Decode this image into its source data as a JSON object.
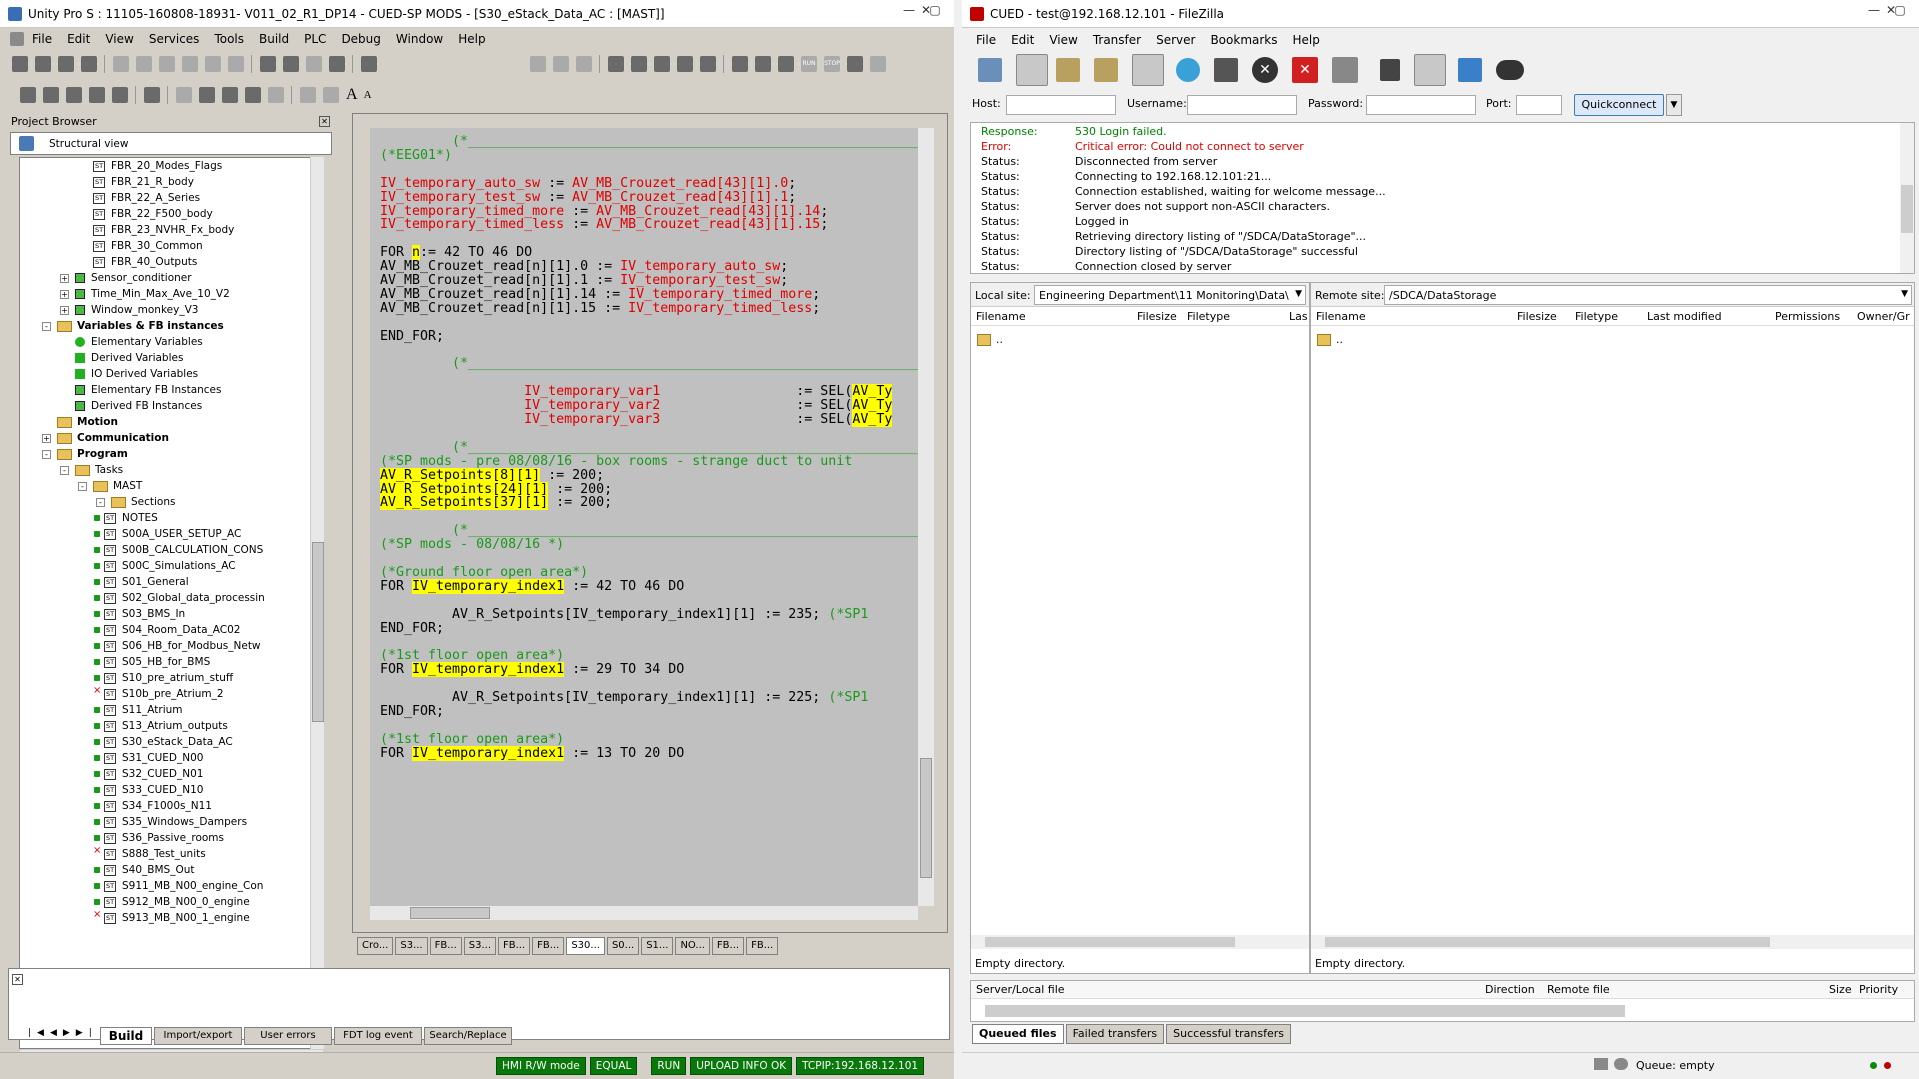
{
  "unity": {
    "title": "Unity Pro S : 11105-160808-18931- V011_02_R1_DP14 - CUED-SP MODS - [S30_eStack_Data_AC : [MAST]]",
    "menu": [
      "File",
      "Edit",
      "View",
      "Services",
      "Tools",
      "Build",
      "PLC",
      "Debug",
      "Window",
      "Help"
    ],
    "project_browser": {
      "title": "Project Browser",
      "view_label": "Structural view",
      "tree": [
        {
          "label": "FBR_20_Modes_Flags",
          "kind": "st",
          "indent": 4
        },
        {
          "label": "FBR_21_R_body",
          "kind": "st",
          "indent": 4
        },
        {
          "label": "FBR_22_A_Series",
          "kind": "st",
          "indent": 4
        },
        {
          "label": "FBR_22_F500_body",
          "kind": "st",
          "indent": 4
        },
        {
          "label": "FBR_23_NVHR_Fx_body",
          "kind": "st",
          "indent": 4
        },
        {
          "label": "FBR_30_Common",
          "kind": "st",
          "indent": 4
        },
        {
          "label": "FBR_40_Outputs",
          "kind": "st",
          "indent": 4
        },
        {
          "label": "Sensor_conditioner",
          "kind": "grid",
          "indent": 2,
          "exp": "+"
        },
        {
          "label": "Time_Min_Max_Ave_10_V2",
          "kind": "grid",
          "indent": 2,
          "exp": "+"
        },
        {
          "label": "Window_monkey_V3",
          "kind": "grid",
          "indent": 2,
          "exp": "+"
        },
        {
          "label": "Variables & FB instances",
          "kind": "folder",
          "indent": 1,
          "exp": "-",
          "bold": true
        },
        {
          "label": "Elementary Variables",
          "kind": "dot",
          "indent": 2
        },
        {
          "label": "Derived Variables",
          "kind": "sq",
          "indent": 2
        },
        {
          "label": "IO Derived Variables",
          "kind": "sq",
          "indent": 2
        },
        {
          "label": "Elementary FB Instances",
          "kind": "grid",
          "indent": 2
        },
        {
          "label": "Derived FB Instances",
          "kind": "grid",
          "indent": 2
        },
        {
          "label": "Motion",
          "kind": "folder",
          "indent": 1,
          "bold": true
        },
        {
          "label": "Communication",
          "kind": "folder",
          "indent": 1,
          "exp": "+",
          "bold": true
        },
        {
          "label": "Program",
          "kind": "folder",
          "indent": 1,
          "exp": "-",
          "bold": true
        },
        {
          "label": "Tasks",
          "kind": "folder",
          "indent": 2,
          "exp": "-"
        },
        {
          "label": "MAST",
          "kind": "folder",
          "indent": 3,
          "exp": "-"
        },
        {
          "label": "Sections",
          "kind": "folder",
          "indent": 4,
          "exp": "-"
        },
        {
          "label": "NOTES",
          "kind": "st",
          "indent": 5,
          "mark": "g"
        },
        {
          "label": "S00A_USER_SETUP_AC",
          "kind": "st",
          "indent": 5,
          "mark": "g"
        },
        {
          "label": "S00B_CALCULATION_CONS",
          "kind": "st",
          "indent": 5,
          "mark": "g"
        },
        {
          "label": "S00C_Simulations_AC",
          "kind": "st",
          "indent": 5,
          "mark": "g"
        },
        {
          "label": "S01_General",
          "kind": "st",
          "indent": 5,
          "mark": "g"
        },
        {
          "label": "S02_Global_data_processin",
          "kind": "st",
          "indent": 5,
          "mark": "g"
        },
        {
          "label": "S03_BMS_In",
          "kind": "st",
          "indent": 5,
          "mark": "g"
        },
        {
          "label": "S04_Room_Data_AC02",
          "kind": "st",
          "indent": 5,
          "mark": "g"
        },
        {
          "label": "S06_HB_for_Modbus_Netw",
          "kind": "st",
          "indent": 5,
          "mark": "g"
        },
        {
          "label": "S05_HB_for_BMS",
          "kind": "st",
          "indent": 5,
          "mark": "g"
        },
        {
          "label": "S10_pre_atrium_stuff",
          "kind": "st",
          "indent": 5,
          "mark": "g"
        },
        {
          "label": "S10b_pre_Atrium_2",
          "kind": "st",
          "indent": 5,
          "mark": "r"
        },
        {
          "label": "S11_Atrium",
          "kind": "st",
          "indent": 5,
          "mark": "g"
        },
        {
          "label": "S13_Atrium_outputs",
          "kind": "st",
          "indent": 5,
          "mark": "g"
        },
        {
          "label": "S30_eStack_Data_AC",
          "kind": "st",
          "indent": 5,
          "mark": "g"
        },
        {
          "label": "S31_CUED_N00",
          "kind": "st",
          "indent": 5,
          "mark": "g"
        },
        {
          "label": "S32_CUED_N01",
          "kind": "st",
          "indent": 5,
          "mark": "g"
        },
        {
          "label": "S33_CUED_N10",
          "kind": "st",
          "indent": 5,
          "mark": "g"
        },
        {
          "label": "S34_F1000s_N11",
          "kind": "st",
          "indent": 5,
          "mark": "g"
        },
        {
          "label": "S35_Windows_Dampers",
          "kind": "st",
          "indent": 5,
          "mark": "g"
        },
        {
          "label": "S36_Passive_rooms",
          "kind": "st",
          "indent": 5,
          "mark": "g"
        },
        {
          "label": "S888_Test_units",
          "kind": "st",
          "indent": 5,
          "mark": "r"
        },
        {
          "label": "S40_BMS_Out",
          "kind": "st",
          "indent": 5,
          "mark": "g"
        },
        {
          "label": "S911_MB_N00_engine_Con",
          "kind": "st",
          "indent": 5,
          "mark": "g"
        },
        {
          "label": "S912_MB_N00_0_engine",
          "kind": "st",
          "indent": 5,
          "mark": "g"
        },
        {
          "label": "S913_MB_N00_1_engine",
          "kind": "st",
          "indent": 5,
          "mark": "r"
        }
      ]
    },
    "code_lines": [
      [
        {
          "t": "         (*____________________________________________________________",
          "c": "cmt"
        }
      ],
      [
        {
          "t": "(*EEG01*)",
          "c": "cmt"
        }
      ],
      [],
      [
        {
          "t": "IV_temporary_auto_sw",
          "c": "var"
        },
        {
          "t": " := "
        },
        {
          "t": "AV_MB_Crouzet_read[43][1].0",
          "c": "var"
        },
        {
          "t": ";"
        }
      ],
      [
        {
          "t": "IV_temporary_test_sw",
          "c": "var"
        },
        {
          "t": " := "
        },
        {
          "t": "AV_MB_Crouzet_read[43][1].1",
          "c": "var"
        },
        {
          "t": ";"
        }
      ],
      [
        {
          "t": "IV_temporary_timed_more",
          "c": "var"
        },
        {
          "t": " := "
        },
        {
          "t": "AV_MB_Crouzet_read[43][1].14",
          "c": "var"
        },
        {
          "t": ";"
        }
      ],
      [
        {
          "t": "IV_temporary_timed_less",
          "c": "var"
        },
        {
          "t": " := "
        },
        {
          "t": "AV_MB_Crouzet_read[43][1].15",
          "c": "var"
        },
        {
          "t": ";"
        }
      ],
      [],
      [
        {
          "t": "FOR "
        },
        {
          "t": "n",
          "c": "hl"
        },
        {
          "t": ":= 42 TO 46 DO"
        }
      ],
      [
        {
          "t": "AV_MB_Crouzet_read[n][1].0 := "
        },
        {
          "t": "IV_temporary_auto_sw",
          "c": "var"
        },
        {
          "t": ";"
        }
      ],
      [
        {
          "t": "AV_MB_Crouzet_read[n][1].1 := "
        },
        {
          "t": "IV_temporary_test_sw",
          "c": "var"
        },
        {
          "t": ";"
        }
      ],
      [
        {
          "t": "AV_MB_Crouzet_read[n][1].14 := "
        },
        {
          "t": "IV_temporary_timed_more",
          "c": "var"
        },
        {
          "t": ";"
        }
      ],
      [
        {
          "t": "AV_MB_Crouzet_read[n][1].15 := "
        },
        {
          "t": "IV_temporary_timed_less",
          "c": "var"
        },
        {
          "t": ";"
        }
      ],
      [],
      [
        {
          "t": "END_FOR;"
        }
      ],
      [],
      [
        {
          "t": "         (*____________________________________________________________",
          "c": "cmt"
        }
      ],
      [],
      [
        {
          "t": "                  "
        },
        {
          "t": "IV_temporary_var1",
          "c": "var"
        },
        {
          "t": "                 := SEL("
        },
        {
          "t": "AV_Ty",
          "c": "hl"
        }
      ],
      [
        {
          "t": "                  "
        },
        {
          "t": "IV_temporary_var2",
          "c": "var"
        },
        {
          "t": "                 := SEL("
        },
        {
          "t": "AV_Ty",
          "c": "hl"
        }
      ],
      [
        {
          "t": "                  "
        },
        {
          "t": "IV_temporary_var3",
          "c": "var"
        },
        {
          "t": "                 := SEL("
        },
        {
          "t": "AV_Ty",
          "c": "hl"
        }
      ],
      [],
      [
        {
          "t": "         (*____________________________________________________________",
          "c": "cmt"
        }
      ],
      [
        {
          "t": "(*SP mods - pre 08/08/16 - box rooms - strange duct to unit",
          "c": "cmt"
        }
      ],
      [
        {
          "t": "AV_R_Setpoints[8][1]",
          "c": "hl"
        },
        {
          "t": " := 200;"
        }
      ],
      [
        {
          "t": "AV_R_Setpoints[24][1]",
          "c": "hl"
        },
        {
          "t": " := 200;"
        }
      ],
      [
        {
          "t": "AV_R_Setpoints[37][1]",
          "c": "hl"
        },
        {
          "t": " := 200;"
        }
      ],
      [],
      [
        {
          "t": "         (*____________________________________________________________",
          "c": "cmt"
        }
      ],
      [
        {
          "t": "(*SP mods - 08/08/16 *)",
          "c": "cmt"
        }
      ],
      [],
      [
        {
          "t": "(*Ground floor open area*)",
          "c": "cmt"
        }
      ],
      [
        {
          "t": "FOR "
        },
        {
          "t": "IV_temporary_index1",
          "c": "hl"
        },
        {
          "t": " := 42 TO 46 DO"
        }
      ],
      [],
      [
        {
          "t": "         AV_R_Setpoints[IV_temporary_index1][1] := 235; "
        },
        {
          "t": "(*SP1",
          "c": "cmt"
        }
      ],
      [
        {
          "t": "END_FOR;"
        }
      ],
      [],
      [
        {
          "t": "(*1st floor open area*)",
          "c": "cmt"
        }
      ],
      [
        {
          "t": "FOR "
        },
        {
          "t": "IV_temporary_index1",
          "c": "hl"
        },
        {
          "t": " := 29 TO 34 DO"
        }
      ],
      [],
      [
        {
          "t": "         AV_R_Setpoints[IV_temporary_index1][1] := 225; "
        },
        {
          "t": "(*SP1",
          "c": "cmt"
        }
      ],
      [
        {
          "t": "END_FOR;"
        }
      ],
      [],
      [
        {
          "t": "(*1st floor open area*)",
          "c": "cmt"
        }
      ],
      [
        {
          "t": "FOR "
        },
        {
          "t": "IV_temporary_index1",
          "c": "hl"
        },
        {
          "t": " := 13 TO 20 DO"
        }
      ]
    ],
    "editor_tabs": [
      "Cro...",
      "S3...",
      "FB...",
      "S3...",
      "FB...",
      "FB...",
      "S30...",
      "S0...",
      "S1...",
      "NO...",
      "FB...",
      "FB..."
    ],
    "active_tab_index": 6,
    "output_tabs": [
      "Build",
      "Import/export",
      "User errors",
      "FDT log event",
      "Search/Replace"
    ],
    "status": [
      "HMI R/W mode",
      "EQUAL",
      "RUN",
      "UPLOAD INFO OK",
      "TCPIP:192.168.12.101"
    ]
  },
  "filezilla": {
    "title": "CUED - test@192.168.12.101 - FileZilla",
    "menu": [
      "File",
      "Edit",
      "View",
      "Transfer",
      "Server",
      "Bookmarks",
      "Help"
    ],
    "quickconnect": {
      "host_label": "Host:",
      "username_label": "Username:",
      "password_label": "Password:",
      "port_label": "Port:",
      "button": "Quickconnect"
    },
    "log": [
      {
        "label": "Response:",
        "text": "530 Login failed.",
        "color": "#008000"
      },
      {
        "label": "Error:",
        "text": "Critical error: Could not connect to server",
        "color": "#e00000"
      },
      {
        "label": "Status:",
        "text": "Disconnected from server"
      },
      {
        "label": "Status:",
        "text": "Connecting to 192.168.12.101:21..."
      },
      {
        "label": "Status:",
        "text": "Connection established, waiting for welcome message..."
      },
      {
        "label": "Status:",
        "text": "Server does not support non-ASCII characters."
      },
      {
        "label": "Status:",
        "text": "Logged in"
      },
      {
        "label": "Status:",
        "text": "Retrieving directory listing of \"/SDCA/DataStorage\"..."
      },
      {
        "label": "Status:",
        "text": "Directory listing of \"/SDCA/DataStorage\" successful"
      },
      {
        "label": "Status:",
        "text": "Connection closed by server"
      }
    ],
    "local": {
      "label": "Local site:",
      "path": "Engineering Department\\11 Monitoring\\Data\\",
      "columns": [
        "Filename",
        "Filesize",
        "Filetype",
        "Las"
      ],
      "row": "..",
      "status": "Empty directory."
    },
    "remote": {
      "label": "Remote site:",
      "path": "/SDCA/DataStorage",
      "columns": [
        "Filename",
        "Filesize",
        "Filetype",
        "Last modified",
        "Permissions",
        "Owner/Gr"
      ],
      "row": "..",
      "status": "Empty directory."
    },
    "queue": {
      "columns": [
        "Server/Local file",
        "Direction",
        "Remote file",
        "Size",
        "Priority"
      ],
      "tabs": [
        "Queued files",
        "Failed transfers",
        "Successful transfers"
      ],
      "status": "Queue: empty"
    }
  },
  "colors": {
    "code_bg": "#c0c0c0",
    "comment": "#1a9a1a",
    "variable": "#e00000",
    "highlight": "#ffff00",
    "status_green": "#08780a"
  }
}
